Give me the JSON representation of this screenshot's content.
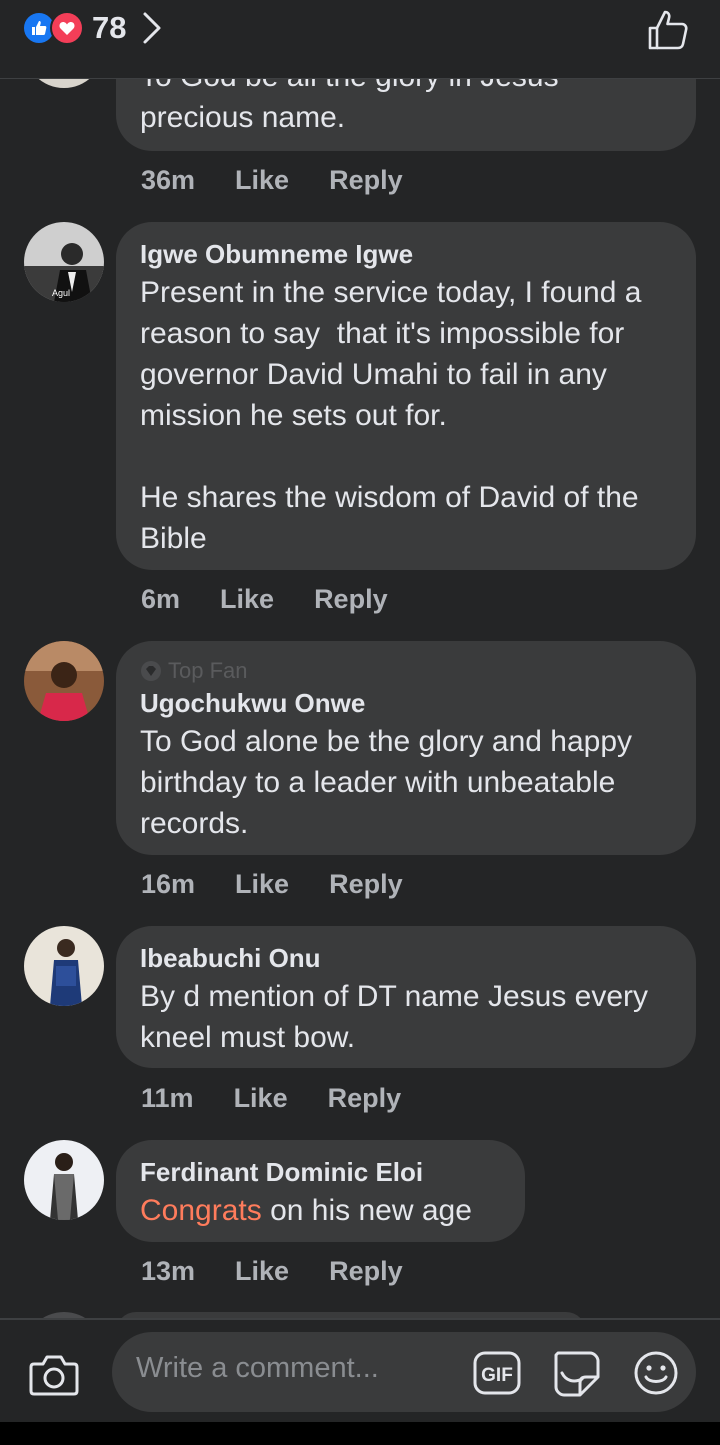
{
  "header": {
    "reaction_count": "78"
  },
  "comments": [
    {
      "text_partial": "To God be all the glory in Jesus",
      "text": "precious name.",
      "time": "36m"
    },
    {
      "name": "Igwe Obumneme Igwe",
      "avatar_caption": "Agul",
      "text": "Present in the service today, I found a reason to say  that it's impossible for governor David Umahi to fail in any mission he sets out for.\n\nHe shares the wisdom of David of the Bible",
      "time": "6m"
    },
    {
      "badge": "Top Fan",
      "name": "Ugochukwu Onwe",
      "text": "To God alone be the glory and happy birthday to a leader with unbeatable records.",
      "time": "16m"
    },
    {
      "name": "Ibeabuchi Onu",
      "text": "By d mention of DT name Jesus every kneel must bow.",
      "time": "11m"
    },
    {
      "name": "Ferdinant Dominic Eloi",
      "text_highlight": "Congrats",
      "text_rest": " on his new age",
      "time": "13m"
    }
  ],
  "actions": {
    "like": "Like",
    "reply": "Reply"
  },
  "composer": {
    "placeholder": "Write a comment...",
    "gif_label": "GIF"
  },
  "colors": {
    "background": "#242526",
    "bubble": "#3a3b3c",
    "highlight": "#ff7c5c",
    "like_blue": "#1877f2",
    "love_red": "#f33e58"
  }
}
